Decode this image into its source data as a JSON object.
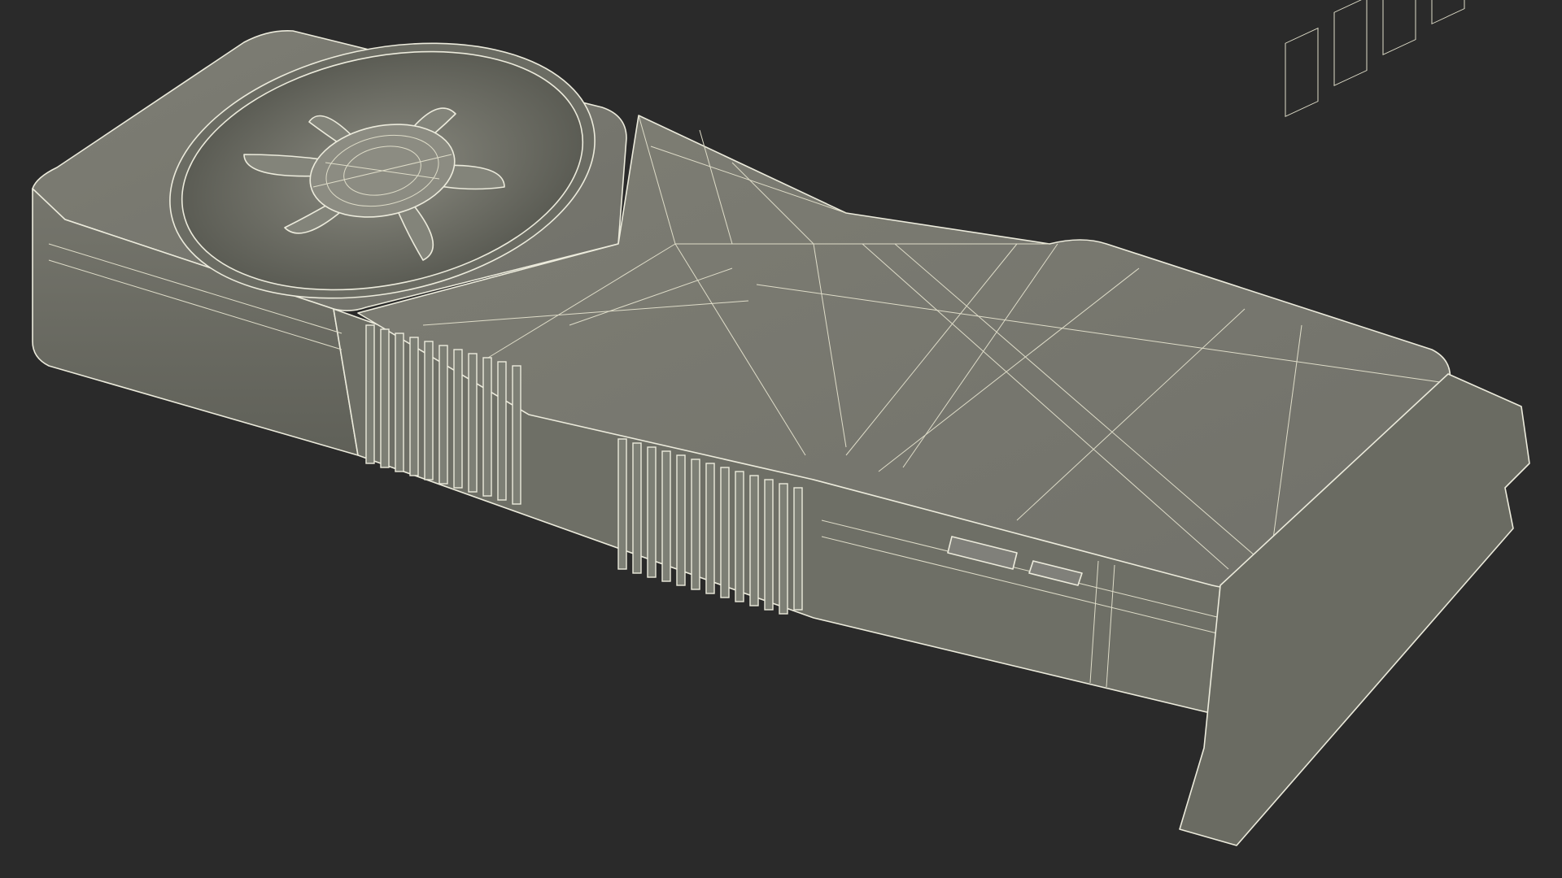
{
  "scene": {
    "subject": "graphics-card-wireframe",
    "colors": {
      "background": "#2a2a2a",
      "surface": "#78786f",
      "surface_dark": "#5f6058",
      "surface_light": "#8a8a80",
      "wire": "#ecebdc"
    }
  }
}
